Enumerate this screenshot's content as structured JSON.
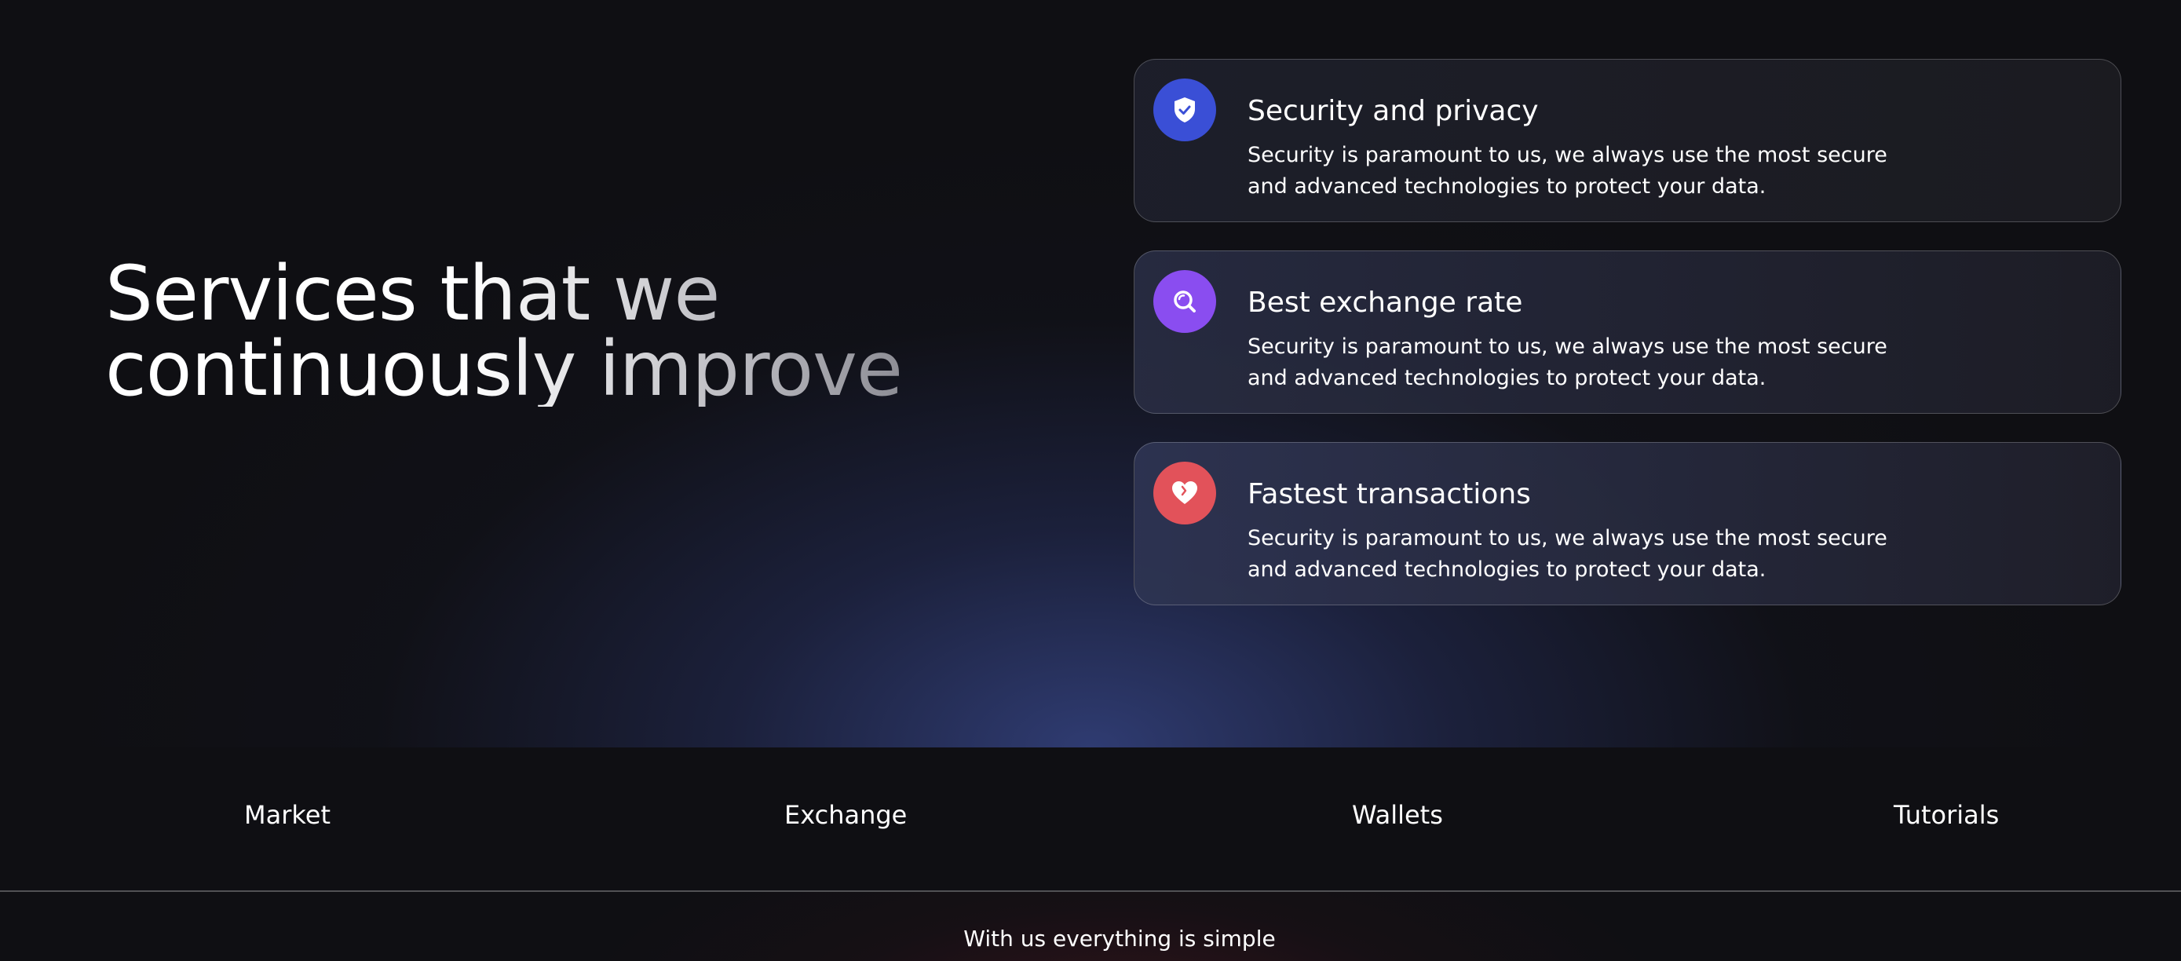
{
  "hero": {
    "title_line1": "Services that we",
    "title_line2": "continuously improve"
  },
  "services": [
    {
      "title": "Security and privacy",
      "description": "Security is paramount to us, we always use the most secure and advanced technologies to protect your data.",
      "icon": "shield-check-icon",
      "color": "#3a4fd6"
    },
    {
      "title": "Best exchange rate",
      "description": "Security is paramount to us, we always use the most secure and advanced technologies to protect your data.",
      "icon": "search-icon",
      "color": "#8a4df0"
    },
    {
      "title": "Fastest transactions",
      "description": "Security is paramount to us, we always use the most secure and advanced technologies to protect your data.",
      "icon": "heart-icon",
      "color": "#e2525a"
    }
  ],
  "nav": {
    "items": [
      "Market",
      "Exchange",
      "Wallets",
      "Tutorials"
    ]
  },
  "footer": {
    "tagline": "With us everything is simple"
  },
  "colors": {
    "background": "#0f0f13",
    "accent_blue": "#3a4fd6",
    "accent_purple": "#8a4df0",
    "accent_red": "#e2525a"
  }
}
